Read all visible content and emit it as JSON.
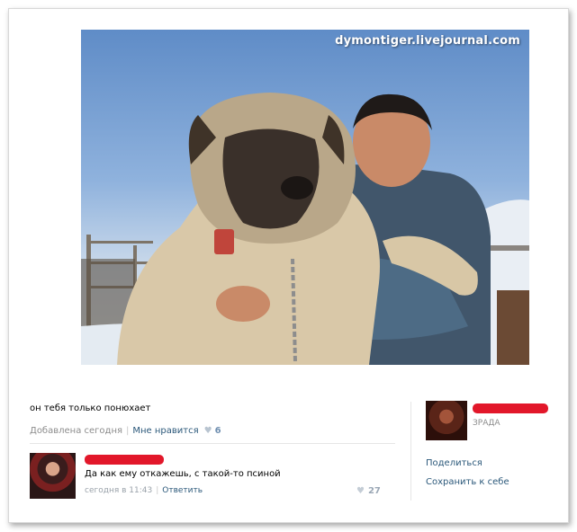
{
  "photo": {
    "watermark": "dymontiger.livejournal.com"
  },
  "post": {
    "text": "он тебя только понюхает",
    "added": "Добавлена сегодня",
    "like_label": "Мне нравится",
    "like_count": "6"
  },
  "comment": {
    "text": "Да как ему откажешь, с такой-то псиной",
    "time": "сегодня в 11:43",
    "reply": "Ответить",
    "likes": "27"
  },
  "author": {
    "subtitle": "ЗРАДА"
  },
  "actions": {
    "share": "Поделиться",
    "save": "Сохранить к себе"
  },
  "colors": {
    "link": "#2b587a",
    "redaction": "#e2172a"
  }
}
